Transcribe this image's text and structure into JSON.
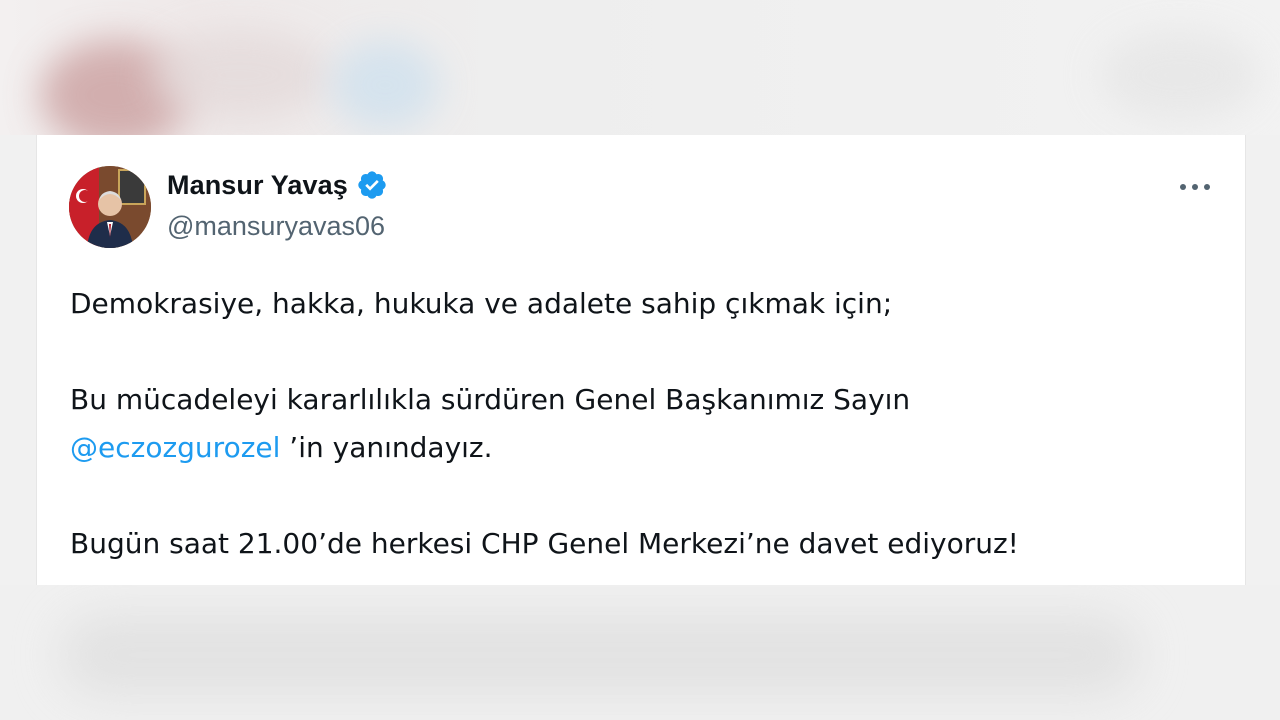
{
  "tweet": {
    "display_name": "Mansur Yavaş",
    "handle": "@mansuryavas06",
    "verified": true,
    "line1": "Demokrasiye, hakka, hukuka ve adalete sahip çıkmak için;",
    "line2": "Bu mücadeleyi kararlılıkla sürdüren Genel Başkanımız Sayın",
    "mention": "@eczozgurozel",
    "line3_rest": " ’in yanındayız.",
    "line4": "Bugün saat 21.00’de herkesi CHP Genel Merkezi’ne davet ediyoruz!"
  },
  "icons": {
    "verified": "verified-badge-icon",
    "more": "more-horizontal-icon"
  },
  "colors": {
    "accent": "#1d9bf0",
    "text": "#0f1419",
    "secondary": "#536471"
  }
}
